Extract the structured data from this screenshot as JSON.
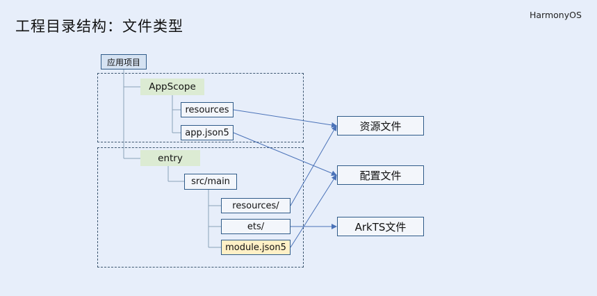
{
  "title": "工程目录结构：文件类型",
  "brand": "HarmonyOS",
  "tree": {
    "root_label": "应用项目",
    "appscope": {
      "label": "AppScope",
      "resources": "resources",
      "app_json": "app.json5"
    },
    "entry": {
      "label": "entry",
      "src_main": "src/main",
      "resources": "resources/",
      "ets": "ets/",
      "module_json": "module.json5"
    }
  },
  "file_types": {
    "resource_file": "资源文件",
    "config_file": "配置文件",
    "arkts_file": "ArkTS文件"
  },
  "colors": {
    "background": "#e7eefa",
    "box_border": "#2e5a88",
    "arrow": "#4a72b8",
    "tree_line": "#8aa1b8",
    "green_highlight": "#dcebd3",
    "yellow_highlight": "#fff0c6",
    "tag_fill": "#d5e2f2"
  }
}
